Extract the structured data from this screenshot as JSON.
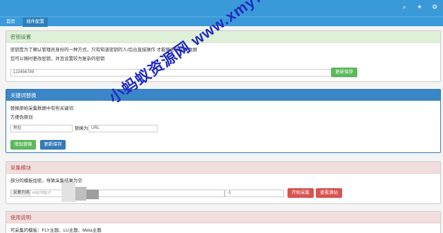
{
  "topbar": {
    "icons": [
      "search-icon",
      "sparkle-icon",
      "gear-icon"
    ],
    "icon_glyphs": [
      "⌕",
      "✦",
      "⚙"
    ]
  },
  "tabs": [
    {
      "label": "首页",
      "active": false
    },
    {
      "label": "插件配置",
      "active": true
    }
  ],
  "secret_panel": {
    "title": "密钥设置",
    "desc1": "密钥是为了确认管理员身份的一种方式，只有知道密钥的人/后台直接操作 才能够更新采集数据",
    "desc2": "您可以随时更改密钥，并且设置较为复杂的密钥",
    "key_value": "123456789",
    "save_label": "更新保存"
  },
  "keyword_panel": {
    "title": "关键词替换",
    "desc1": "替换原始采集数据中有些关键词",
    "desc2": "方便伪原创",
    "address_label": "地址",
    "replace_label": "替换为",
    "url_value": "URL",
    "add_label": "增加替换",
    "save_label": "更新保存"
  },
  "collect_panel": {
    "title": "采集模块",
    "desc": "部分的模板加密，导致采集结果为空",
    "list_label": "采集列表",
    "list_placeholder": "exp:http://",
    "page_value": "-1",
    "start_label": "开始采集",
    "view_label": "查看源站"
  },
  "usage_panel": {
    "title": "使用说明",
    "desc": "可采集的模板：FLY主题、LU主题、Meta主题"
  },
  "watermark": "小蚂蚁资源网 www.xmy7.com"
}
